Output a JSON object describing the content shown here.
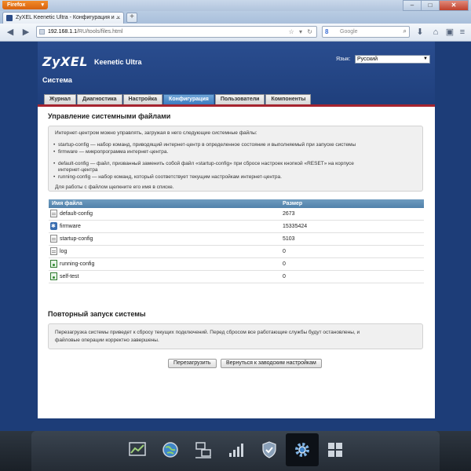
{
  "browser": {
    "app_button": "Firefox",
    "tab_title": "ZyXEL Keenetic Ultra - Конфигурация и ...",
    "url_host": "192.168.1.1",
    "url_path": "/RU/tools/files.html",
    "search_placeholder": "Google"
  },
  "header": {
    "logo": "ZyXEL",
    "product": "Keenetic Ultra",
    "section": "Система",
    "language_label": "Язык:",
    "language_value": "Русский"
  },
  "tabs": [
    {
      "label": "Журнал"
    },
    {
      "label": "Диагностика"
    },
    {
      "label": "Настройка"
    },
    {
      "label": "Конфигурация",
      "active": true
    },
    {
      "label": "Пользователи"
    },
    {
      "label": "Компоненты"
    }
  ],
  "files_section": {
    "title": "Управление системными файлами",
    "intro": "Интернет-центром можно управлять, загружая в него следующие системные файлы:",
    "bullets_1": [
      "startup-config — набор команд, приводящий интернет-центр в определенное состояние и выполняемый при запуске системы",
      "firmware — микропрограмма интернет-центра."
    ],
    "bullets_2a_line1": "default-config — файл, призванный заменить собой файл «startup-config» при сбросе настроек кнопкой «RESET» на корпусе",
    "bullets_2a_line2": "интернет-центра",
    "bullets_2b": "running-config — набор команд, который соответствует текущим настройкам интернет-центра.",
    "hint": "Для работы с файлом щелкните его имя в списке.",
    "col_name": "Имя файла",
    "col_size": "Размер",
    "files": [
      {
        "name": "default-config",
        "size": "2673",
        "icon": "document-icon"
      },
      {
        "name": "firmware",
        "size": "15335424",
        "icon": "firmware-icon"
      },
      {
        "name": "startup-config",
        "size": "5103",
        "icon": "document-icon"
      },
      {
        "name": "log",
        "size": "0",
        "icon": "document-icon"
      },
      {
        "name": "running-config",
        "size": "0",
        "icon": "script-icon"
      },
      {
        "name": "self-test",
        "size": "0",
        "icon": "script-icon"
      }
    ]
  },
  "reboot_section": {
    "title": "Повторный запуск системы",
    "text_line1": "Перезагрузка системы приведет к сбросу текущих подключений. Перед сбросом все работающие службы будут остановлены, и",
    "text_line2": "файловые операции корректно завершены.",
    "reboot_button": "Перезагрузить",
    "factory_button": "Вернуться к заводским настройкам"
  },
  "dock": [
    {
      "icon": "chart-icon"
    },
    {
      "icon": "globe-icon"
    },
    {
      "icon": "network-icon"
    },
    {
      "icon": "signal-bars-icon"
    },
    {
      "icon": "shield-icon"
    },
    {
      "icon": "gear-icon",
      "active": true
    },
    {
      "icon": "grid-icon"
    }
  ],
  "colors": {
    "brand_blue": "#1f3f7c",
    "active_tab": "#3b7bc0",
    "accent_red": "#a6242f",
    "table_header": "#5081aa"
  }
}
